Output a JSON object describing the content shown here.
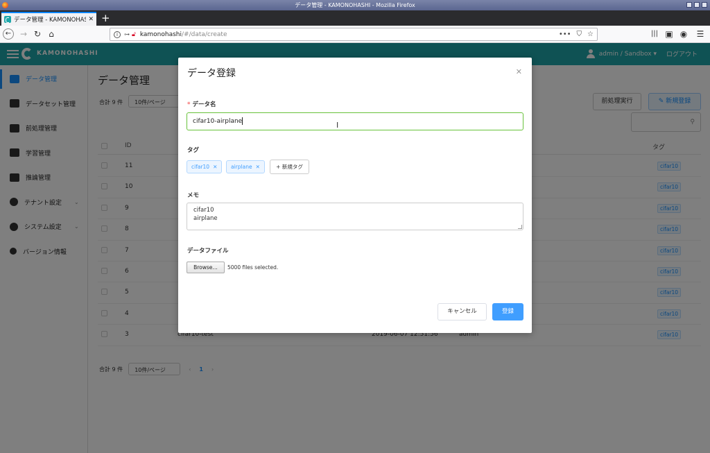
{
  "window": {
    "title": "データ管理 - KAMONOHASHI - Mozilla Firefox"
  },
  "browser": {
    "tab_title": "データ管理 - KAMONOHASHI",
    "url_host": "kamonohashi",
    "url_path": "/#/data/create"
  },
  "header": {
    "brand": "KAMONOHASHI",
    "user": "admin / Sandbox ▾",
    "logout": "ログアウト"
  },
  "sidebar": {
    "items": [
      {
        "label": "データ管理",
        "icon": "image-icon"
      },
      {
        "label": "データセット管理",
        "icon": "images-icon"
      },
      {
        "label": "前処理管理",
        "icon": "edit-icon"
      },
      {
        "label": "学習管理",
        "icon": "briefcase-icon"
      },
      {
        "label": "推論管理",
        "icon": "clipboard-icon"
      },
      {
        "label": "テナント設定",
        "icon": "gear-icon"
      },
      {
        "label": "システム設定",
        "icon": "gears-icon"
      },
      {
        "label": "バージョン情報",
        "icon": "info-icon"
      }
    ]
  },
  "page": {
    "title": "データ管理",
    "total": "合計 9 件",
    "per_page": "10件/ページ",
    "btn_preprocess": "前処理実行",
    "btn_new": "新規登録",
    "col_id": "ID",
    "col_tag": "タグ",
    "rows": [
      {
        "id": "11",
        "name": "",
        "date": "",
        "user": "",
        "tag": "cifar10"
      },
      {
        "id": "10",
        "name": "",
        "date": "",
        "user": "",
        "tag": "cifar10"
      },
      {
        "id": "9",
        "name": "",
        "date": "",
        "user": "",
        "tag": "cifar10"
      },
      {
        "id": "8",
        "name": "",
        "date": "",
        "user": "",
        "tag": "cifar10"
      },
      {
        "id": "7",
        "name": "",
        "date": "",
        "user": "",
        "tag": "cifar10"
      },
      {
        "id": "6",
        "name": "",
        "date": "",
        "user": "",
        "tag": "cifar10"
      },
      {
        "id": "5",
        "name": "",
        "date": "",
        "user": "",
        "tag": "cifar10"
      },
      {
        "id": "4",
        "name": "",
        "date": "",
        "user": "",
        "tag": "cifar10"
      },
      {
        "id": "3",
        "name": "cifar10-test",
        "date": "2019-06-07 12:51:56",
        "user": "admin",
        "tag": "cifar10"
      }
    ],
    "pager_total": "合計 9 件",
    "pager_per_page": "10件/ページ",
    "pager_prev": "‹",
    "pager_page": "1",
    "pager_next": "›"
  },
  "dialog": {
    "title": "データ登録",
    "name_label": "データ名",
    "name_value": "cifar10-airplane",
    "tag_label": "タグ",
    "tags": [
      "cifar10",
      "airplane"
    ],
    "new_tag": "+ 新規タグ",
    "memo_label": "メモ",
    "memo_value": "cifar10\nairplane",
    "file_label": "データファイル",
    "browse": "Browse…",
    "file_status": "5000 files selected.",
    "cancel": "キャンセル",
    "submit": "登録"
  }
}
